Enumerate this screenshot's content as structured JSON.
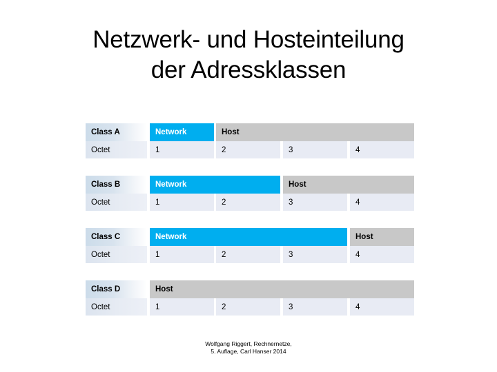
{
  "slide": {
    "title_line1": "Netzwerk- und Hosteinteilung",
    "title_line2": "der Adressklassen"
  },
  "colors": {
    "network": "#00AEEF",
    "host": "#C8C8C8",
    "octet_cell": "#E8EBF4",
    "class_label_start": "#CCDCEA",
    "class_label_end": "#FFFFFF",
    "text": "#000000"
  },
  "table": {
    "octet_row_label": "Octet",
    "network_label": "Network",
    "host_label": "Host",
    "octet_numbers": [
      "1",
      "2",
      "3",
      "4"
    ],
    "blocks": [
      {
        "class_label": "Class A",
        "network_octets": 1,
        "host_octets": 3,
        "spans": [
          {
            "kind": "network",
            "label": "Network",
            "start": 1,
            "end": 1
          },
          {
            "kind": "host",
            "label": "Host",
            "start": 2,
            "end": 4
          }
        ],
        "octets": [
          "1",
          "2",
          "3",
          "4"
        ]
      },
      {
        "class_label": "Class B",
        "network_octets": 2,
        "host_octets": 2,
        "spans": [
          {
            "kind": "network",
            "label": "Network",
            "start": 1,
            "end": 2
          },
          {
            "kind": "host",
            "label": "Host",
            "start": 3,
            "end": 4
          }
        ],
        "octets": [
          "1",
          "2",
          "3",
          "4"
        ]
      },
      {
        "class_label": "Class C",
        "network_octets": 3,
        "host_octets": 1,
        "spans": [
          {
            "kind": "network",
            "label": "Network",
            "start": 1,
            "end": 3
          },
          {
            "kind": "host",
            "label": "Host",
            "start": 4,
            "end": 4
          }
        ],
        "octets": [
          "1",
          "2",
          "3",
          "4"
        ]
      },
      {
        "class_label": "Class D",
        "network_octets": 0,
        "host_octets": 4,
        "spans": [
          {
            "kind": "host",
            "label": "Host",
            "start": 1,
            "end": 4
          }
        ],
        "octets": [
          "1",
          "2",
          "3",
          "4"
        ]
      }
    ]
  },
  "footer": {
    "line1": "Wolfgang Riggert, Rechnernetze,",
    "line2": "5. Auflage, Carl Hanser 2014"
  }
}
